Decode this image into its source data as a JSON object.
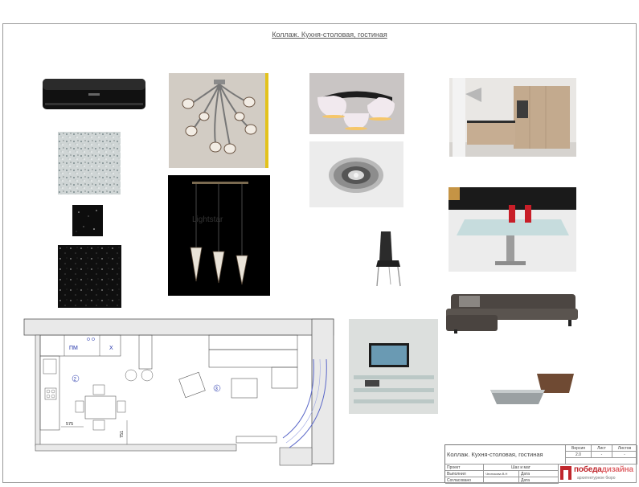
{
  "sheet": {
    "title": "Коллаж. Кухня-столовая, гостиная"
  },
  "plan": {
    "labels": {
      "pm": "ПМ",
      "x": "Х",
      "room2": "2",
      "room3": "3",
      "dim575": "575",
      "dim751": "751"
    }
  },
  "images": {
    "pendant_brand": "Lightstar"
  },
  "titleblock": {
    "name": "Коллаж. Кухня-столовая, гостиная",
    "version_label": "Версия",
    "version_value": "2.0",
    "sheet_label": "Лист",
    "sheet_value": "-",
    "sheets_label": "Листов",
    "sheets_value": "-",
    "project_label": "Проект",
    "project_value": "Шах и мат",
    "executed_label": "Выполнил",
    "executed_value": "Чеснокова В.Н",
    "date_label": "Дата",
    "agreed_label": "Согласовано",
    "date2_label": "Дата"
  },
  "logo": {
    "brand_part1": "победа",
    "brand_part2": "дизайна",
    "subtitle": "архитектурное бюро",
    "brand_color": "#c0272d"
  }
}
